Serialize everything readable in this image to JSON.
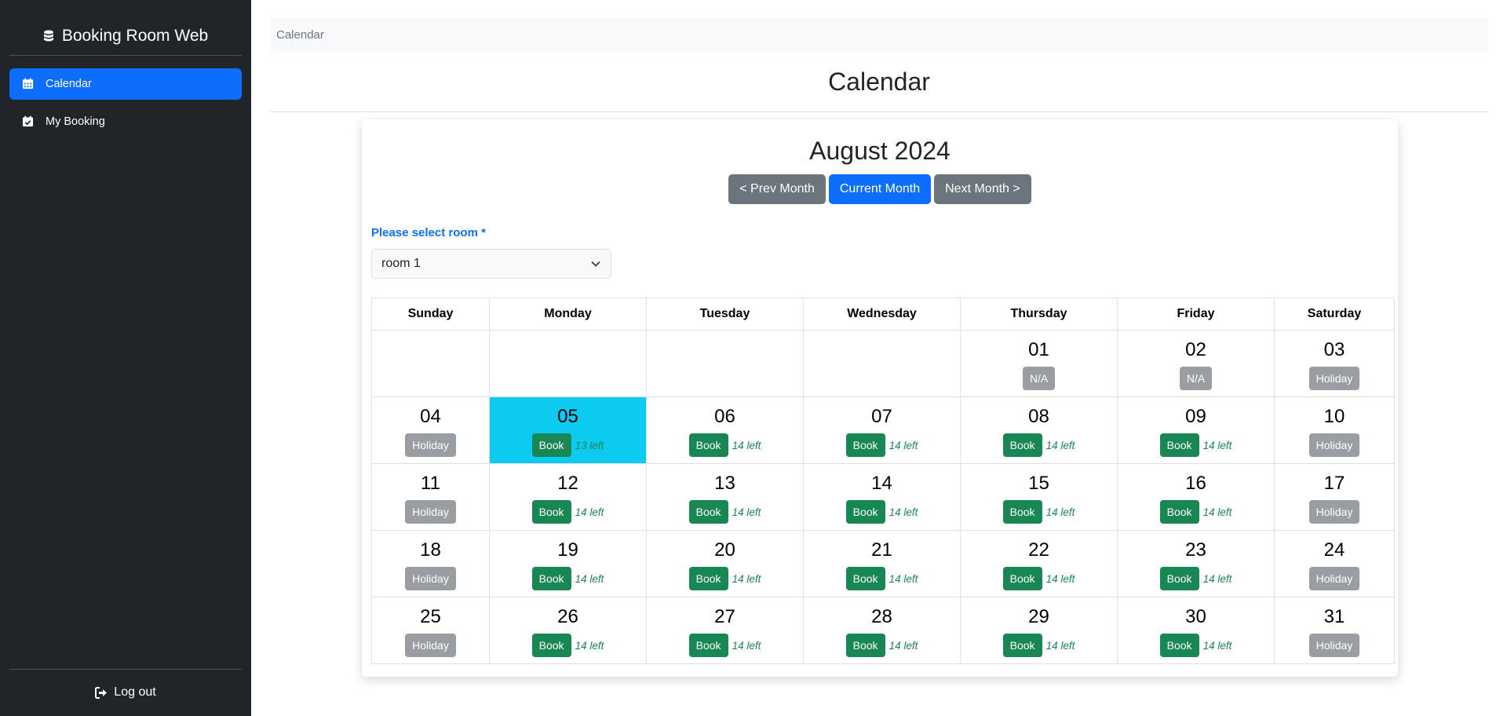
{
  "sidebar": {
    "brand": "Booking Room Web",
    "items": [
      {
        "label": "Calendar",
        "icon": "calendar-icon",
        "active": true
      },
      {
        "label": "My Booking",
        "icon": "calendar-check-icon",
        "active": false
      }
    ],
    "logout": "Log out"
  },
  "breadcrumb": "Calendar",
  "page_title": "Calendar",
  "calendar": {
    "month_title": "August 2024",
    "prev_label": "< Prev Month",
    "current_label": "Current Month",
    "next_label": "Next Month >",
    "room_label": "Please select room *",
    "room_value": "room 1",
    "weekdays": [
      "Sunday",
      "Monday",
      "Tuesday",
      "Wednesday",
      "Thursday",
      "Friday",
      "Saturday"
    ],
    "weeks": [
      [
        null,
        null,
        null,
        null,
        {
          "day": "01",
          "status": "N/A"
        },
        {
          "day": "02",
          "status": "N/A"
        },
        {
          "day": "03",
          "status": "Holiday"
        }
      ],
      [
        {
          "day": "04",
          "status": "Holiday"
        },
        {
          "day": "05",
          "status": "Book",
          "left": "13 left",
          "today": true
        },
        {
          "day": "06",
          "status": "Book",
          "left": "14 left"
        },
        {
          "day": "07",
          "status": "Book",
          "left": "14 left"
        },
        {
          "day": "08",
          "status": "Book",
          "left": "14 left"
        },
        {
          "day": "09",
          "status": "Book",
          "left": "14 left"
        },
        {
          "day": "10",
          "status": "Holiday"
        }
      ],
      [
        {
          "day": "11",
          "status": "Holiday"
        },
        {
          "day": "12",
          "status": "Book",
          "left": "14 left"
        },
        {
          "day": "13",
          "status": "Book",
          "left": "14 left"
        },
        {
          "day": "14",
          "status": "Book",
          "left": "14 left"
        },
        {
          "day": "15",
          "status": "Book",
          "left": "14 left"
        },
        {
          "day": "16",
          "status": "Book",
          "left": "14 left"
        },
        {
          "day": "17",
          "status": "Holiday"
        }
      ],
      [
        {
          "day": "18",
          "status": "Holiday"
        },
        {
          "day": "19",
          "status": "Book",
          "left": "14 left"
        },
        {
          "day": "20",
          "status": "Book",
          "left": "14 left"
        },
        {
          "day": "21",
          "status": "Book",
          "left": "14 left"
        },
        {
          "day": "22",
          "status": "Book",
          "left": "14 left"
        },
        {
          "day": "23",
          "status": "Book",
          "left": "14 left"
        },
        {
          "day": "24",
          "status": "Holiday"
        }
      ],
      [
        {
          "day": "25",
          "status": "Holiday"
        },
        {
          "day": "26",
          "status": "Book",
          "left": "14 left"
        },
        {
          "day": "27",
          "status": "Book",
          "left": "14 left"
        },
        {
          "day": "28",
          "status": "Book",
          "left": "14 left"
        },
        {
          "day": "29",
          "status": "Book",
          "left": "14 left"
        },
        {
          "day": "30",
          "status": "Book",
          "left": "14 left"
        },
        {
          "day": "31",
          "status": "Holiday"
        }
      ]
    ]
  },
  "colors": {
    "sidebar_bg": "#212529",
    "primary": "#0d6efd",
    "secondary": "#6c757d",
    "success": "#198754",
    "today": "#0dcaf0",
    "holiday": "#9a9ea3"
  }
}
